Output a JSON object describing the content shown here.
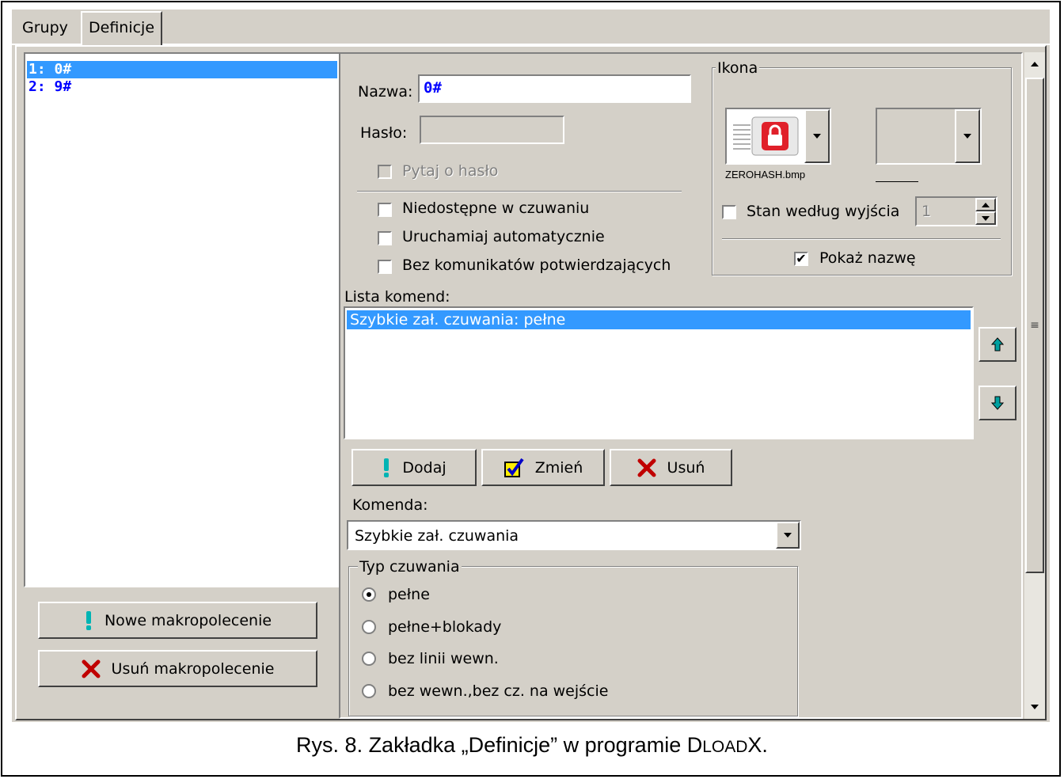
{
  "tabs": {
    "inactive": "Grupy",
    "active": "Definicje"
  },
  "macro_list": [
    {
      "label": "1: 0#",
      "selected": true
    },
    {
      "label": "2: 9#",
      "selected": false
    }
  ],
  "buttons": {
    "new_macro": "Nowe makropolecenie",
    "delete_macro": "Usuń makropolecenie",
    "add": "Dodaj",
    "change": "Zmień",
    "remove": "Usuń"
  },
  "form": {
    "name_label": "Nazwa:",
    "name_value": "0#",
    "password_label": "Hasło:",
    "password_value": "",
    "ask_password": "Pytaj o hasło",
    "unavailable_armed": "Niedostępne w czuwaniu",
    "auto_run": "Uruchamiaj automatycznie",
    "no_confirm": "Bez komunikatów potwierdzających"
  },
  "icon_group": {
    "legend": "Ikona",
    "icon_file": "ZEROHASH.bmp",
    "state_by_output": "Stan według wyjścia",
    "output_value": "1",
    "show_name": "Pokaż nazwę",
    "show_name_checked": true
  },
  "commands": {
    "label": "Lista komend:",
    "items": [
      "Szybkie zał. czuwania: pełne"
    ]
  },
  "command": {
    "label": "Komenda:",
    "selected": "Szybkie zał. czuwania"
  },
  "arm_type": {
    "legend": "Typ czuwania",
    "options": [
      "pełne",
      "pełne+blokady",
      "bez linii wewn.",
      "bez wewn.,bez cz. na wejście"
    ],
    "selected_index": 0
  },
  "caption": {
    "prefix": "Rys. 8. Zakładka „Definicje” w programie ",
    "app_initial": "D",
    "app_smallcaps": "LOAD",
    "app_final": "X",
    "suffix": "."
  },
  "colors": {
    "selection": "#3399ff",
    "macro_text": "#0000ff",
    "window_bg": "#d4d0c8",
    "icon_red": "#e0202a",
    "icon_cyan": "#00a0a0"
  }
}
